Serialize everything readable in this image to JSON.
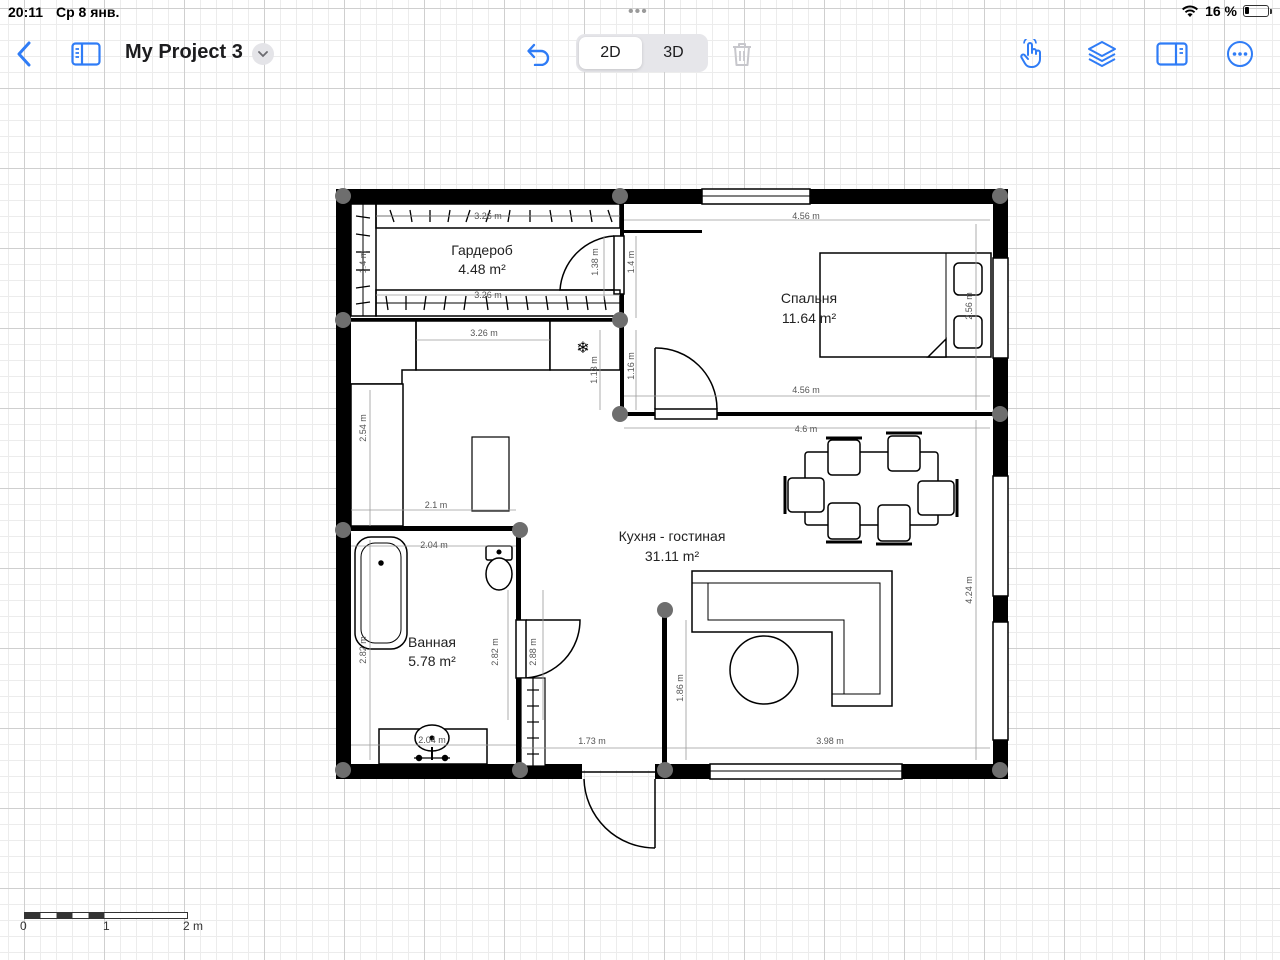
{
  "status": {
    "time": "20:11",
    "date": "Ср 8 янв.",
    "battery": "16 %"
  },
  "toolbar": {
    "project_title": "My Project 3",
    "view_2d": "2D",
    "view_3d": "3D",
    "active_view": "2D",
    "icons": [
      "back-chevron-icon",
      "sidebar-icon",
      "chevron-down-icon",
      "undo-icon",
      "trash-icon",
      "hand-tap-icon",
      "layers-icon",
      "inspector-panel-icon",
      "more-icon"
    ],
    "accent_color": "#2f7cf6"
  },
  "rooms": {
    "wardrobe": {
      "name": "Гардероб",
      "area": "4.48 m²"
    },
    "bedroom": {
      "name": "Спальня",
      "area": "11.64 m²"
    },
    "kitchen": {
      "name": "Кухня - гостиная",
      "area": "31.11 m²"
    },
    "bathroom": {
      "name": "Ванная",
      "area": "5.78 m²"
    }
  },
  "dimensions": {
    "wardrobe_top": "3.26 m",
    "wardrobe_bottom": "3.26 m",
    "wardrobe_right": "1.38 m",
    "wardrobe_left": "1.4 m",
    "wardrobe_door": "1.4 m",
    "kitchen_counter": "3.26 m",
    "fridge_h": "1.13 m",
    "bed_left": "1.16 m",
    "bedroom_top": "4.56 m",
    "bedroom_bottom": "4.56 m",
    "bed_right": "2.56 m",
    "hall_left": "2.54 m",
    "hall_bottom": "2.1 m",
    "living_top": "4.6 m",
    "living_right": "4.24 m",
    "bath_top": "2.04 m",
    "bath_left": "2.82 m",
    "bath_right": "2.82 m",
    "bath_bottom": "2.04 m",
    "corridor": "2.88 m",
    "entry_bottom": "1.73 m",
    "living_left": "1.86 m",
    "living_bottom": "3.98 m"
  },
  "scale": {
    "labels": [
      "0",
      "1",
      "2 m"
    ]
  }
}
